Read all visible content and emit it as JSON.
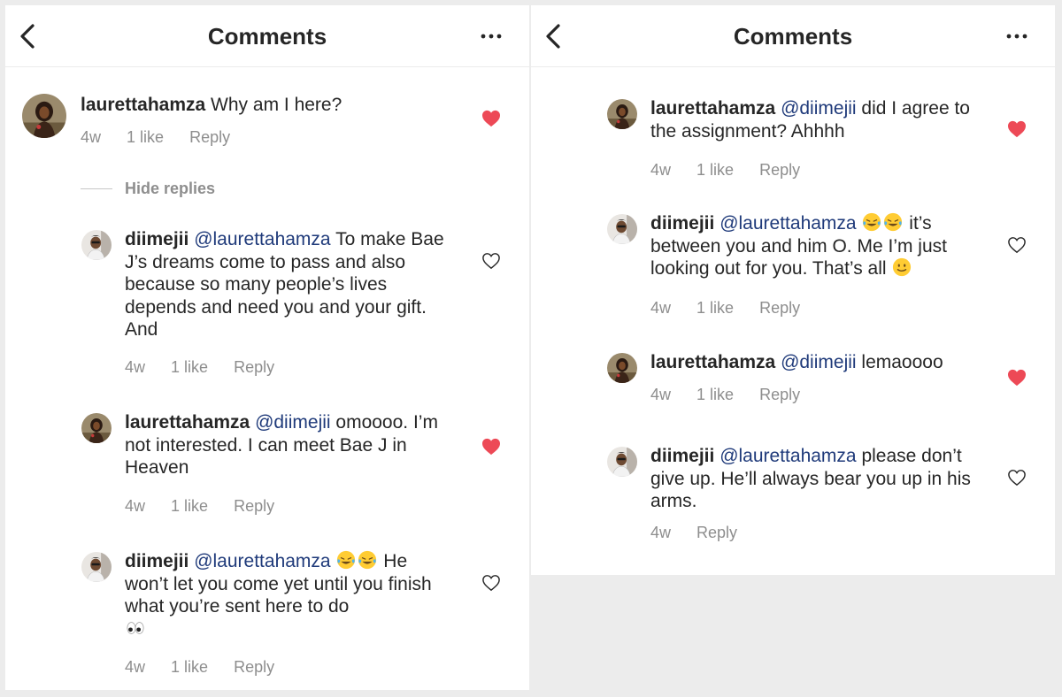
{
  "left_panel": {
    "header": {
      "title": "Comments"
    },
    "comments": [
      {
        "username": "laurettahamza",
        "mention": "",
        "text": " Why am I here?",
        "time": "4w",
        "likes": "1 like",
        "reply": "Reply",
        "liked": true
      },
      {
        "username": "diimejii",
        "mention": "@laurettahamza",
        "text": " To make Bae J’s dreams come to pass and also because so many people’s lives depends and need you and your gift. And",
        "time": "4w",
        "likes": "1 like",
        "reply": "Reply",
        "liked": false
      },
      {
        "username": "laurettahamza",
        "mention": "@diimejii",
        "text": " omoooo. I’m not interested. I can meet Bae J in Heaven",
        "time": "4w",
        "likes": "1 like",
        "reply": "Reply",
        "liked": true
      },
      {
        "username": "diimejii",
        "mention": "@laurettahamza",
        "text_after_emoji": " He won’t let you come yet until you finish what you’re sent here to do",
        "time": "4w",
        "likes": "1 like",
        "reply": "Reply",
        "liked": false
      }
    ],
    "hide_replies": "Hide replies"
  },
  "right_panel": {
    "header": {
      "title": "Comments"
    },
    "comments": [
      {
        "username": "laurettahamza",
        "mention": "@diimejii",
        "text": " did I agree to the assignment? Ahhhh",
        "time": "4w",
        "likes": "1 like",
        "reply": "Reply",
        "liked": true
      },
      {
        "username": "diimejii",
        "mention": "@laurettahamza",
        "text_after_emoji": " it’s between you and him O. Me I’m just looking out for you. That’s all",
        "time": "4w",
        "likes": "1 like",
        "reply": "Reply",
        "liked": false
      },
      {
        "username": "laurettahamza",
        "mention": "@diimejii",
        "text": " lemaoooo",
        "time": "4w",
        "likes": "1 like",
        "reply": "Reply",
        "liked": true
      },
      {
        "username": "diimejii",
        "mention": "@laurettahamza",
        "text": " please don’t give up. He’ll always bear you up in his arms.",
        "time": "4w",
        "reply": "Reply",
        "liked": false
      }
    ]
  },
  "colors": {
    "heart_liked": "#ed4956",
    "mention": "#1f3a7a",
    "meta": "#8e8e8e",
    "text": "#262626"
  },
  "icons": {
    "back": "chevron-left-icon",
    "more": "more-horizontal-icon",
    "heart": "heart-icon",
    "emoji_laugh": "face-with-tears-of-joy-icon",
    "emoji_eyes": "eyes-icon",
    "emoji_smile": "slightly-smiling-face-icon"
  }
}
